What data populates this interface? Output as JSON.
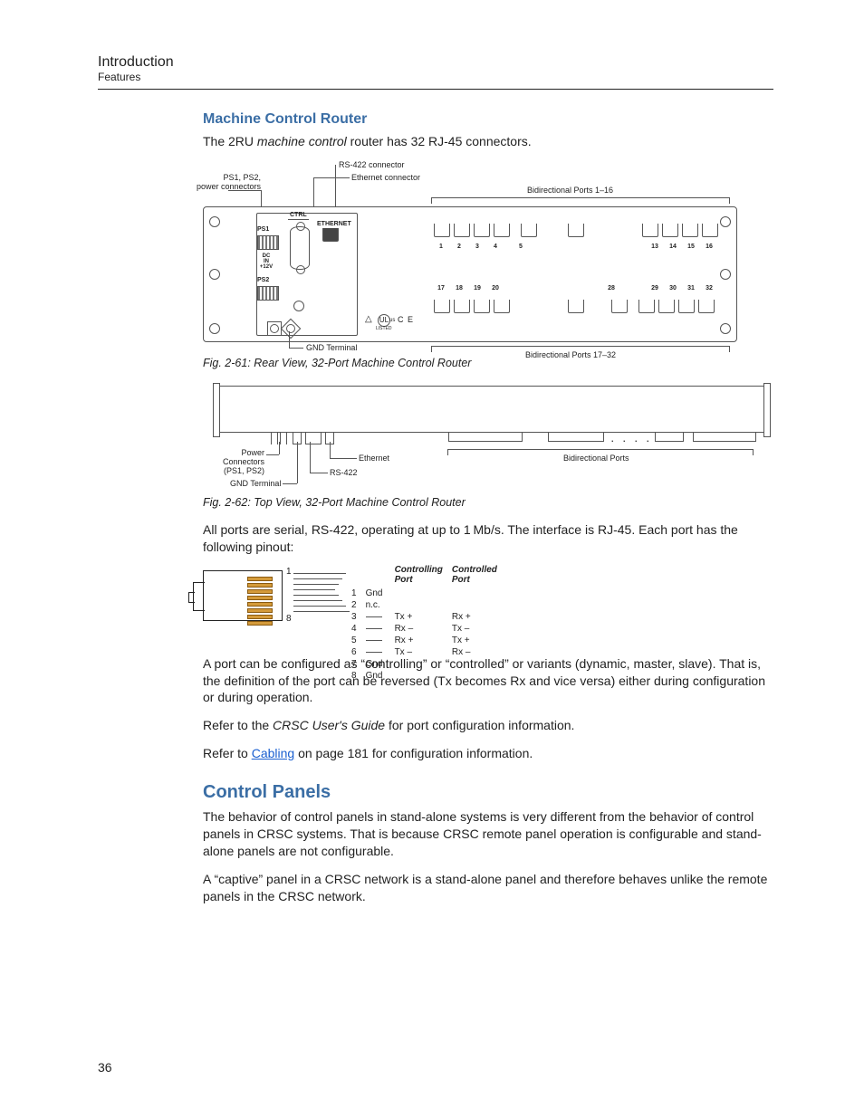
{
  "header": {
    "chapter": "Introduction",
    "section": "Features"
  },
  "h3": "Machine Control Router",
  "intro": {
    "pre": "The 2RU ",
    "ital": "machine control",
    "post": " router has 32 RJ-45 connectors."
  },
  "fig61": {
    "callouts": {
      "rs422": "RS-422 connector",
      "eth": "Ethernet connector",
      "ps": "PS1, PS2,\npower connectors",
      "gnd": "GND Terminal",
      "ports_top": "Bidirectional Ports 1–16",
      "ports_bot": "Bidirectional Ports 17–32"
    },
    "panel": {
      "ctrl": "CTRL",
      "ethernet": "ETHERNET",
      "ps1": "PS1",
      "ps2": "PS2",
      "dc": "DC\nIN\n+12V",
      "ce": "C E",
      "ul_us": "us",
      "ul_listed": "LISTED"
    },
    "portnums_top_left": [
      "1",
      "2",
      "3",
      "4",
      "5"
    ],
    "portnums_top_right": [
      "13",
      "14",
      "15",
      "16"
    ],
    "portnums_bot_left": [
      "17",
      "18",
      "19",
      "20"
    ],
    "portnums_bot_mid": [
      "28"
    ],
    "portnums_bot_right": [
      "29",
      "30",
      "31",
      "32"
    ],
    "caption": "Fig. 2-61: Rear View, 32-Port Machine Control Router"
  },
  "fig62": {
    "callouts": {
      "power": "Power\nConnectors\n(PS1, PS2)",
      "gnd": "GND Terminal",
      "rs422": "RS-422",
      "eth": "Ethernet",
      "ports": "Bidirectional Ports"
    },
    "dots": ". . . .",
    "caption": "Fig. 2-62: Top View, 32-Port Machine Control Router"
  },
  "para_allports": "All ports are serial, RS-422, operating at up to 1 Mb/s. The interface is RJ-45. Each port has the following pinout:",
  "pinout": {
    "head": {
      "ctrl": "Controlling\nPort",
      "ctld": "Controlled\nPort"
    },
    "rows": [
      {
        "n": "1",
        "sig": "Gnd",
        "a": "",
        "b": ""
      },
      {
        "n": "2",
        "sig": "n.c.",
        "a": "",
        "b": ""
      },
      {
        "n": "3",
        "sig": "",
        "a": "Tx +",
        "b": "Rx +"
      },
      {
        "n": "4",
        "sig": "",
        "a": "Rx –",
        "b": "Tx –"
      },
      {
        "n": "5",
        "sig": "",
        "a": "Rx +",
        "b": "Tx +"
      },
      {
        "n": "6",
        "sig": "",
        "a": "Tx –",
        "b": "Rx –"
      },
      {
        "n": "7",
        "sig": "Gnd",
        "a": "",
        "b": ""
      },
      {
        "n": "8",
        "sig": "Gnd",
        "a": "",
        "b": ""
      }
    ]
  },
  "para_config": "A port can be configured as “controlling” or “controlled” or variants (dynamic, master, slave). That is, the definition of the port can be reversed (Tx becomes Rx and vice versa) either during configuration or during operation.",
  "para_refer1": {
    "pre": "Refer to the ",
    "ital": "CRSC User's Guide ",
    "post": "for port configuration information."
  },
  "para_refer2": {
    "pre": "Refer to ",
    "link": "Cabling",
    "post": " on page 181 for configuration information."
  },
  "h2": "Control Panels",
  "para_cp1": "The behavior of control panels in stand-alone systems is very different from the behavior of control panels in CRSC systems. That is because CRSC remote panel operation is configurable and stand-alone panels are not configurable.",
  "para_cp2": "A “captive” panel in a CRSC network is a stand-alone panel and therefore behaves unlike the remote panels in the CRSC network.",
  "pagenum": "36"
}
